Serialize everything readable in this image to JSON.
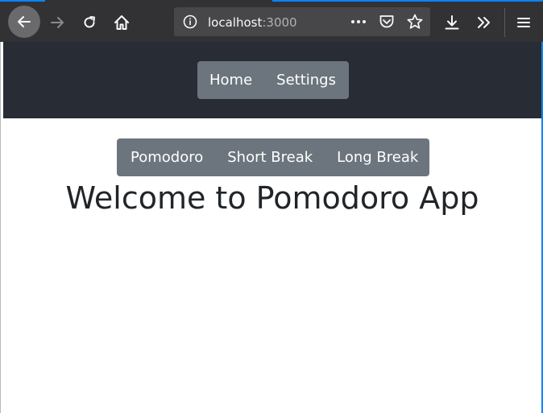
{
  "browser": {
    "url_host": "localhost",
    "url_port": ":3000",
    "icons": {
      "back": "back-arrow-icon",
      "forward": "forward-arrow-icon",
      "reload": "reload-icon",
      "home": "home-icon",
      "info": "info-icon",
      "more": "more-dots-icon",
      "pocket": "pocket-icon",
      "bookmark": "star-icon",
      "downloads": "download-icon",
      "overflow": "overflow-chevrons-icon",
      "menu": "hamburger-menu-icon"
    },
    "colors": {
      "toolbar": "#323234",
      "url_bar": "#474749",
      "accent": "#0a84ff"
    }
  },
  "app": {
    "nav": {
      "home_label": "Home",
      "settings_label": "Settings"
    },
    "timer_modes": {
      "pomodoro_label": "Pomodoro",
      "short_break_label": "Short Break",
      "long_break_label": "Long Break"
    },
    "heading": "Welcome to Pomodoro App",
    "colors": {
      "header_bg": "#282c34",
      "button_bg": "#6c757d",
      "heading_text": "#212529"
    }
  }
}
